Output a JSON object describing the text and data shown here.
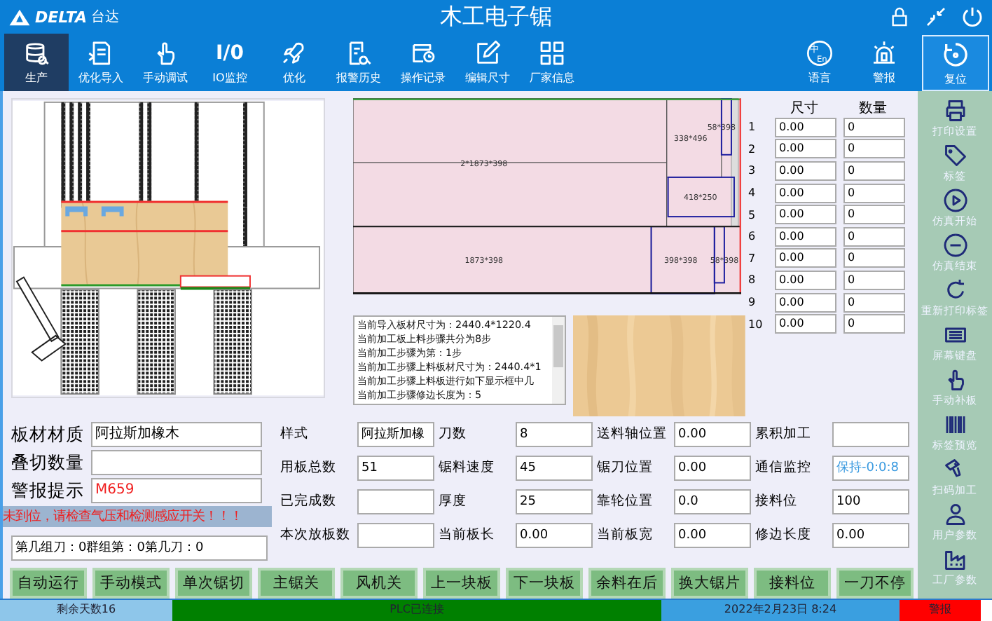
{
  "header": {
    "logo": "DELTA",
    "logo_cn": "台达",
    "title": "木工电子锯"
  },
  "tabs": [
    {
      "label": "生产",
      "selected": true
    },
    {
      "label": "优化导入",
      "selected": false
    },
    {
      "label": "手动调试",
      "selected": false
    },
    {
      "label": "IO监控",
      "glyph": "I/0",
      "selected": false
    },
    {
      "label": "优化",
      "selected": false
    },
    {
      "label": "报警历史",
      "selected": false
    },
    {
      "label": "操作记录",
      "selected": false
    },
    {
      "label": "编辑尺寸",
      "selected": false
    },
    {
      "label": "厂家信息",
      "selected": false
    }
  ],
  "tools": [
    {
      "label": "语言",
      "glyphs": [
        "中",
        "En"
      ]
    },
    {
      "label": "警报"
    }
  ],
  "reset_button": {
    "label": "复位"
  },
  "layout": {
    "pieces": [
      "2*1873*398",
      "338*496",
      "58*398",
      "418*250",
      "1873*398",
      "398*398",
      "58*398"
    ]
  },
  "log_lines": [
    "当前导入板材尺寸为：2440.4*1220.4",
    "当前加工板上料步骤共分为8步",
    "当前加工步骤为第：1步",
    "当前加工步骤上料板材尺寸为：2440.4*1",
    "当前加工步骤上料板进行如下显示框中几",
    "当前加工步骤修边长度为：5"
  ],
  "size_table": {
    "columns": [
      "尺寸",
      "数量"
    ],
    "rows": [
      {
        "no": "1",
        "size": "0.00",
        "qty": "0"
      },
      {
        "no": "2",
        "size": "0.00",
        "qty": "0"
      },
      {
        "no": "3",
        "size": "0.00",
        "qty": "0"
      },
      {
        "no": "4",
        "size": "0.00",
        "qty": "0"
      },
      {
        "no": "5",
        "size": "0.00",
        "qty": "0"
      },
      {
        "no": "6",
        "size": "0.00",
        "qty": "0"
      },
      {
        "no": "7",
        "size": "0.00",
        "qty": "0"
      },
      {
        "no": "8",
        "size": "0.00",
        "qty": "0"
      },
      {
        "no": "9",
        "size": "0.00",
        "qty": "0"
      },
      {
        "no": "10",
        "size": "0.00",
        "qty": "0"
      }
    ]
  },
  "material": {
    "rows": [
      {
        "label": "板材材质",
        "value": "阿拉斯加橡木"
      },
      {
        "label": "叠切数量"
      },
      {
        "label": "警报提示",
        "value": "M659",
        "kind": "alarm"
      }
    ],
    "alarm_message": "未到位，请检查气压和检测感应开关！！！",
    "knife_info": "第几组刀：0群组第：0第几刀：0"
  },
  "params": [
    {
      "label": "样式",
      "value": "阿拉斯加橡"
    },
    {
      "label": "刀数",
      "value": "8"
    },
    {
      "label": "送料轴位置",
      "value": "0.00"
    },
    {
      "label": "累积加工"
    },
    {
      "label": "用板总数",
      "value": "51"
    },
    {
      "label": "锯料速度",
      "value": "45"
    },
    {
      "label": "锯刀位置",
      "value": "0.00"
    },
    {
      "label": "通信监控",
      "value": "保持-0:0:8",
      "kind": "status"
    },
    {
      "label": "已完成数"
    },
    {
      "label": "厚度",
      "value": "25"
    },
    {
      "label": "靠轮位置",
      "value": "0.0"
    },
    {
      "label": "接料位",
      "value": "100"
    },
    {
      "label": "本次放板数"
    },
    {
      "label": "当前板长",
      "value": "0.00"
    },
    {
      "label": "当前板宽",
      "value": "0.00"
    },
    {
      "label": "修边长度",
      "value": "0.00"
    }
  ],
  "buttons": [
    "自动运行",
    "手动模式",
    "单次锯切",
    "主锯关",
    "风机关",
    "上一块板",
    "下一块板",
    "余料在后",
    "换大锯片",
    "接料位",
    "一刀不停"
  ],
  "sidebar": [
    {
      "label": "打印设置"
    },
    {
      "label": "标签"
    },
    {
      "label": "仿真开始"
    },
    {
      "label": "仿真结束"
    },
    {
      "label": "重新打印标签"
    },
    {
      "label": "屏幕键盘"
    },
    {
      "label": "手动补板"
    },
    {
      "label": "标签预览"
    },
    {
      "label": "扫码加工"
    },
    {
      "label": "用户参数"
    },
    {
      "label": "工厂参数"
    }
  ],
  "status_bar": [
    {
      "text": "剩余天数16",
      "color": "#8ec6ea"
    },
    {
      "text": "PLC已连接",
      "color": "#008000"
    },
    {
      "text": "2022年2月23日 8:24",
      "color": "#3a9fe0"
    },
    {
      "text": "警报",
      "color": "#ff0000"
    }
  ]
}
